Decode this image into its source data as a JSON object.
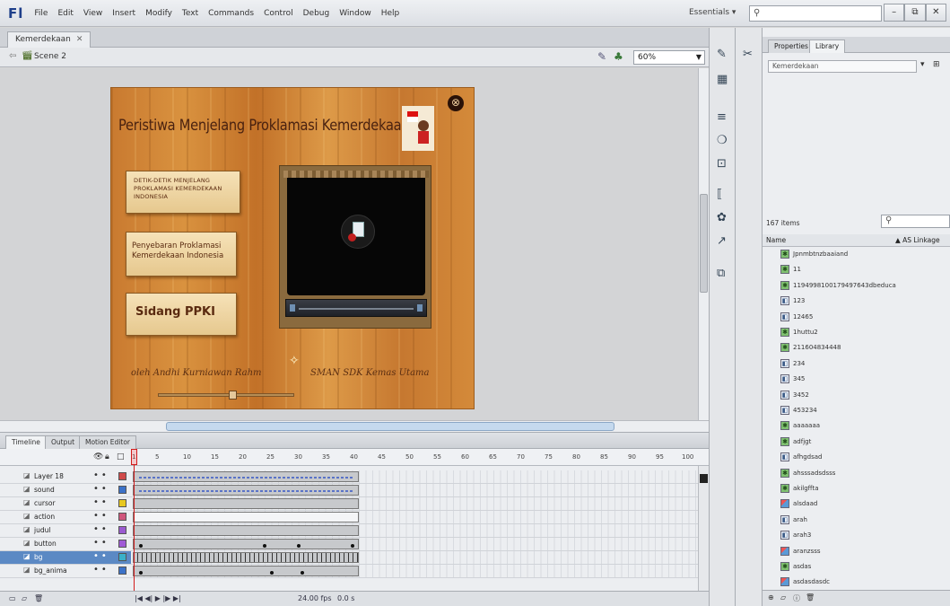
{
  "app": {
    "logo": "Fl",
    "menu": [
      "File",
      "Edit",
      "View",
      "Insert",
      "Modify",
      "Text",
      "Commands",
      "Control",
      "Debug",
      "Window",
      "Help"
    ],
    "workspace": "Essentials ▾",
    "window_controls": [
      "–",
      "⧉",
      "✕"
    ]
  },
  "document": {
    "tab": "Kemerdekaan",
    "tab_close": "✕",
    "scene": "Scene 2",
    "zoom": "60%"
  },
  "stage": {
    "title": "Peristiwa Menjelang Proklamasi Kemerdekaan RI",
    "close_glyph": "⊗",
    "buttons": [
      "DETIK-DETIK MENJELANG PROKLAMASI KEMERDEKAAN INDONESIA",
      "Penyebaran Proklamasi Kemerdekaan Indonesia",
      "Sidang PPKI"
    ],
    "credit_left": "oleh Andhi Kurniawan Rahm",
    "credit_right": "SMAN SDK Kemas Utama"
  },
  "timeline": {
    "tabs": [
      "Timeline",
      "Output",
      "Motion Editor"
    ],
    "frame_numbers": [
      "1",
      "5",
      "10",
      "15",
      "20",
      "25",
      "30",
      "35",
      "40",
      "45",
      "50",
      "55",
      "60",
      "65",
      "70",
      "75",
      "80",
      "85",
      "90",
      "95",
      "100"
    ],
    "layers": [
      {
        "name": "Layer 18",
        "color": "#d04a4a"
      },
      {
        "name": "sound",
        "color": "#3c72c8"
      },
      {
        "name": "cursor",
        "color": "#e8c820"
      },
      {
        "name": "action",
        "color": "#d0567c"
      },
      {
        "name": "judul",
        "color": "#9a5ad0"
      },
      {
        "name": "button",
        "color": "#a05ad6"
      },
      {
        "name": "bg",
        "color": "#3ab0c8"
      },
      {
        "name": "bg_anima",
        "color": "#3c72c8"
      }
    ],
    "footer": {
      "controls": "|◀ ◀| ▶ |▶ ▶|",
      "fps": "24.00 fps",
      "time": "0.0 s"
    }
  },
  "library": {
    "tabs": [
      "Properties",
      "Library"
    ],
    "doc": "Kemerdekaan",
    "count": "167 items",
    "col_name": "Name",
    "col_linkage": "▲ AS Linkage",
    "items": [
      {
        "name": "Jpnmbtnzbaaiand",
        "kind": "movieclip"
      },
      {
        "name": "11",
        "kind": "movieclip"
      },
      {
        "name": "1194998100179497643dbeduca",
        "kind": "movieclip"
      },
      {
        "name": "123",
        "kind": "graphic"
      },
      {
        "name": "12465",
        "kind": "graphic"
      },
      {
        "name": "1huttu2",
        "kind": "movieclip"
      },
      {
        "name": "211604834448",
        "kind": "movieclip"
      },
      {
        "name": "234",
        "kind": "graphic"
      },
      {
        "name": "345",
        "kind": "graphic"
      },
      {
        "name": "3452",
        "kind": "graphic"
      },
      {
        "name": "453234",
        "kind": "graphic"
      },
      {
        "name": "aaaaaaa",
        "kind": "movieclip"
      },
      {
        "name": "adfjgt",
        "kind": "movieclip"
      },
      {
        "name": "afhgdsad",
        "kind": "graphic"
      },
      {
        "name": "ahsssadsdsss",
        "kind": "movieclip"
      },
      {
        "name": "akilgffta",
        "kind": "movieclip"
      },
      {
        "name": "alsdaad",
        "kind": "bitmap"
      },
      {
        "name": "arah",
        "kind": "graphic"
      },
      {
        "name": "arah3",
        "kind": "graphic"
      },
      {
        "name": "aranzsss",
        "kind": "bitmap"
      },
      {
        "name": "asdas",
        "kind": "movieclip"
      },
      {
        "name": "asdasdasdc",
        "kind": "bitmap"
      }
    ]
  },
  "colors": {
    "chrome": "#eceef1",
    "selection": "#5b89c4",
    "playhead": "#d21b1b",
    "stage_wood": "#c97a30"
  }
}
